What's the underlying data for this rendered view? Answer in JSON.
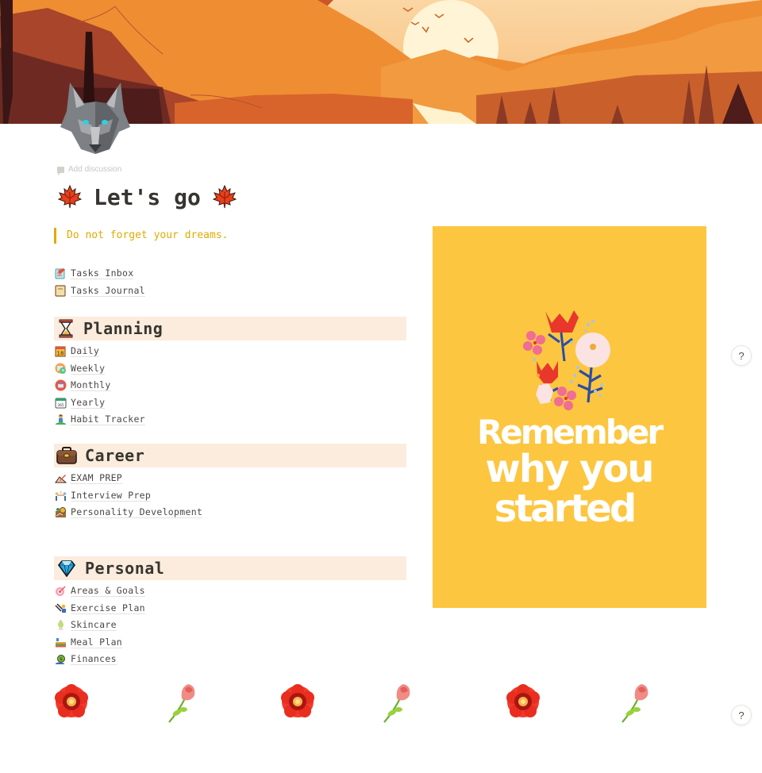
{
  "cover": {
    "description": "sunset mountain landscape",
    "colors": {
      "sky": "#f9c98d",
      "sun": "#fff5d6",
      "mountain": "#ee8a2f",
      "dark": "#6b2a1e"
    }
  },
  "page_icon": "wolf-icon",
  "add_discussion": "Add discussion",
  "title": {
    "text": "Let's go",
    "left_emoji": "maple-leaf",
    "right_emoji": "maple-leaf"
  },
  "quote": {
    "text": "Do not forget your dreams.",
    "color": "#dfab01"
  },
  "top_links": [
    {
      "label": "Tasks Inbox",
      "icon": "memo-icon"
    },
    {
      "label": "Tasks Journal",
      "icon": "ledger-icon"
    }
  ],
  "sections": [
    {
      "title": "Planning",
      "icon": "hourglass-icon",
      "items": [
        {
          "label": "Daily",
          "icon": "calendar-18-icon"
        },
        {
          "label": "Weekly",
          "icon": "calendar-clock-icon"
        },
        {
          "label": "Monthly",
          "icon": "calendar-circle-icon"
        },
        {
          "label": "Yearly",
          "icon": "calendar-365-icon"
        },
        {
          "label": "Habit Tracker",
          "icon": "meditation-icon"
        }
      ]
    },
    {
      "title": "Career",
      "icon": "briefcase-icon",
      "items": [
        {
          "label": "EXAM PREP",
          "icon": "writing-hand-icon"
        },
        {
          "label": "Interview Prep",
          "icon": "interview-icon"
        },
        {
          "label": "Personality Development",
          "icon": "growth-icon"
        }
      ]
    },
    {
      "title": "Personal",
      "icon": "gem-icon",
      "items": [
        {
          "label": "Areas & Goals",
          "icon": "target-icon"
        },
        {
          "label": "Exercise Plan",
          "icon": "exercise-icon"
        },
        {
          "label": "Skincare",
          "icon": "face-mask-icon"
        },
        {
          "label": "Meal Plan",
          "icon": "meal-icon"
        },
        {
          "label": "Finances",
          "icon": "money-bag-icon"
        }
      ]
    }
  ],
  "section_bg": "#fbecdd",
  "poster": {
    "text_lines": [
      "Remember",
      "why you",
      "started"
    ],
    "bg": "#fdc640"
  },
  "help_label": "?",
  "flower_row": [
    "red-flower",
    "rose",
    "red-flower",
    "rose",
    "red-flower",
    "rose"
  ]
}
